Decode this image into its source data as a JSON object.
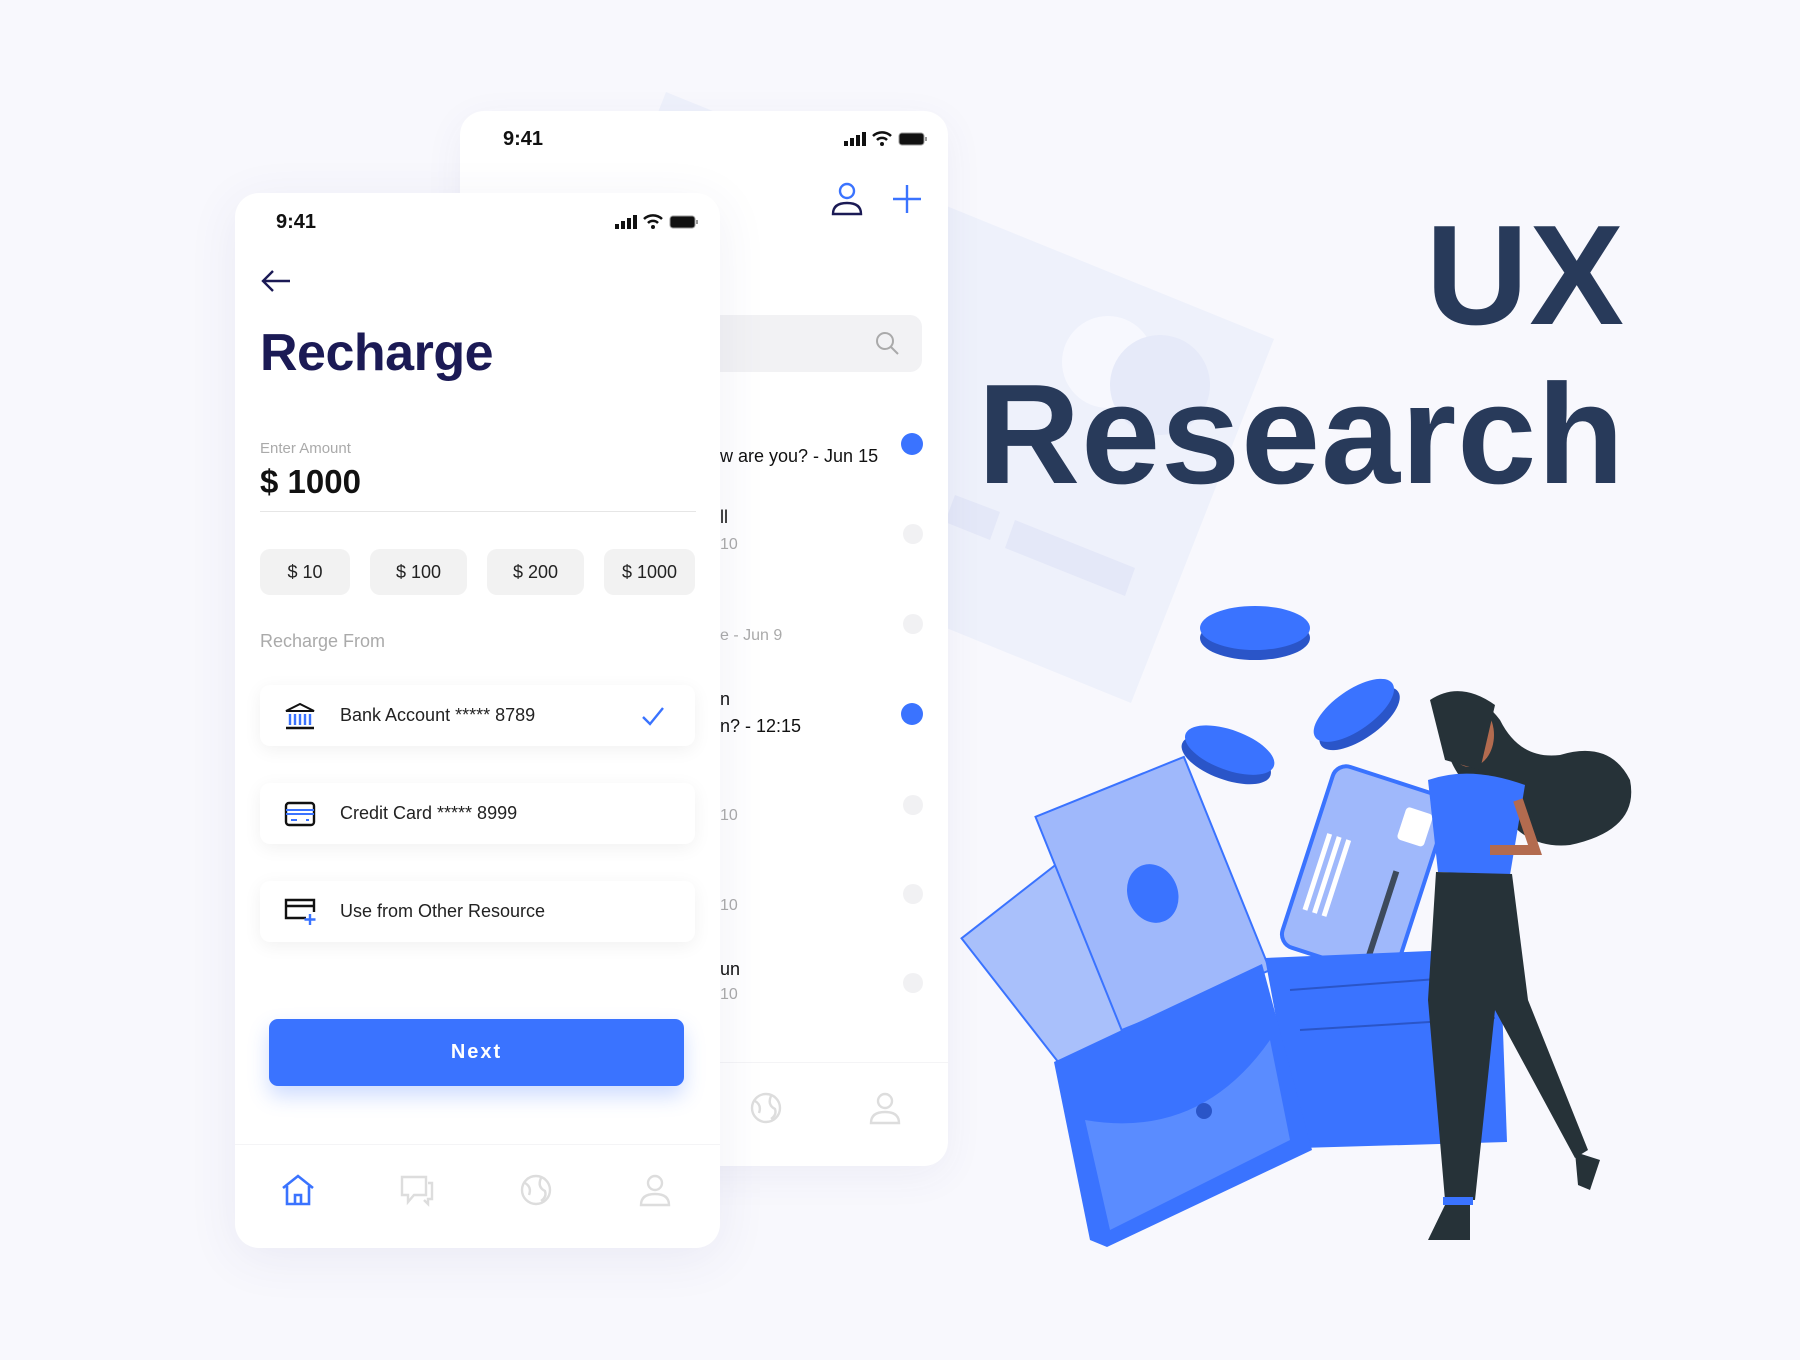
{
  "colors": {
    "accent": "#3a73ff",
    "title": "#1b1a55",
    "headline": "#283a5a",
    "background": "#f8f8fd"
  },
  "headline": {
    "line1": "UX",
    "line2": "Research"
  },
  "back_phone": {
    "time": "9:41",
    "icons": [
      "signal-icon",
      "wifi-icon",
      "battery-icon",
      "user-icon",
      "plus-icon",
      "search-icon"
    ],
    "list": [
      {
        "line1": "w are you? - Jun 15",
        "line2": "",
        "unread": true
      },
      {
        "line1": "ll",
        "line2": "10",
        "unread": false
      },
      {
        "line1": "",
        "line2": "e - Jun 9",
        "unread": false
      },
      {
        "line1": "n",
        "line2": "n? - 12:15",
        "unread": true
      },
      {
        "line1": "",
        "line2": "10",
        "unread": false
      },
      {
        "line1": "",
        "line2": "10",
        "unread": false
      },
      {
        "line1": "un",
        "line2": "10",
        "unread": false
      }
    ],
    "nav_icons": [
      "globe-icon",
      "profile-icon"
    ]
  },
  "front_phone": {
    "time": "9:41",
    "title": "Recharge",
    "amount_label": "Enter Amount",
    "amount_value": "$ 1000",
    "quick_amounts": [
      "$ 10",
      "$ 100",
      "$ 200",
      "$ 1000"
    ],
    "source_label": "Recharge From",
    "sources": [
      {
        "label": "Bank Account ***** 8789",
        "icon": "bank-icon",
        "selected": true
      },
      {
        "label": "Credit Card ***** 8999",
        "icon": "credit-card-icon",
        "selected": false
      },
      {
        "label": "Use from Other Resource",
        "icon": "add-card-icon",
        "selected": false
      }
    ],
    "next_label": "Next",
    "nav": [
      {
        "icon": "home-icon",
        "active": true
      },
      {
        "icon": "chat-icon",
        "active": false
      },
      {
        "icon": "globe-icon",
        "active": false
      },
      {
        "icon": "profile-icon",
        "active": false
      }
    ]
  }
}
